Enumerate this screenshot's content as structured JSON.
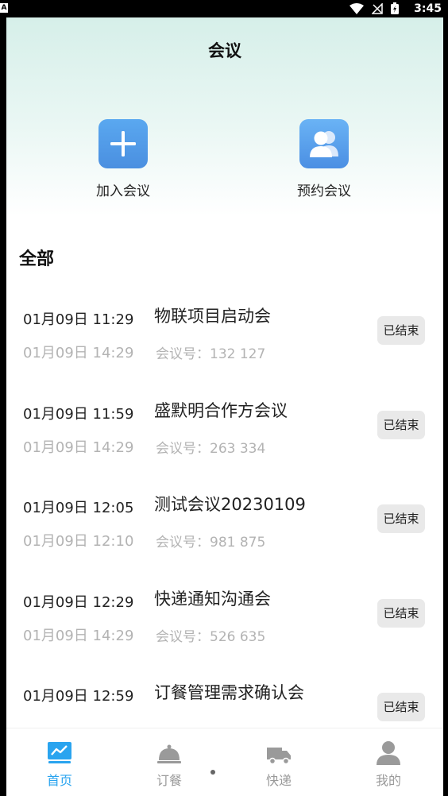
{
  "status_bar": {
    "indicator": "A",
    "time": "3:45"
  },
  "header": {
    "title": "会议"
  },
  "actions": [
    {
      "label": "加入会议",
      "icon": "plus-icon"
    },
    {
      "label": "预约会议",
      "icon": "people-icon"
    }
  ],
  "section": {
    "title": "全部"
  },
  "meetings": [
    {
      "start": "01月09日 11:29",
      "title": "物联项目启动会",
      "end": "01月09日 14:29",
      "code": "会议号：132 127",
      "status": "已结束"
    },
    {
      "start": "01月09日 11:59",
      "title": "盛默明合作方会议",
      "end": "01月09日 14:29",
      "code": "会议号：263 334",
      "status": "已结束"
    },
    {
      "start": "01月09日 12:05",
      "title": "测试会议20230109",
      "end": "01月09日 12:10",
      "code": "会议号：981 875",
      "status": "已结束"
    },
    {
      "start": "01月09日 12:29",
      "title": "快递通知沟通会",
      "end": "01月09日 14:29",
      "code": "会议号：526 635",
      "status": "已结束"
    },
    {
      "start": "01月09日 12:59",
      "title": "订餐管理需求确认会",
      "end": "",
      "code": "",
      "status": "已结束"
    }
  ],
  "tabs": [
    {
      "label": "首页",
      "icon": "chart-board-icon",
      "active": true
    },
    {
      "label": "订餐",
      "icon": "cloche-icon",
      "active": false
    },
    {
      "label": "快递",
      "icon": "truck-icon",
      "active": false
    },
    {
      "label": "我的",
      "icon": "user-icon",
      "active": false
    }
  ],
  "colors": {
    "accent": "#2aa4ef",
    "tile": "#4a8fe0",
    "muted": "#b3b3b3",
    "badge_bg": "#e9e9e9"
  }
}
